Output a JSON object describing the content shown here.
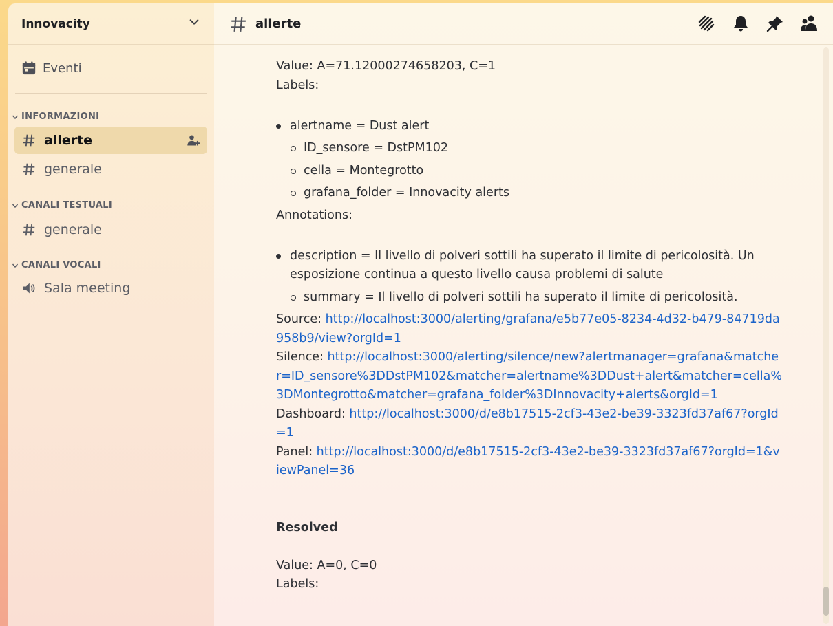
{
  "server": {
    "name": "Innovacity"
  },
  "sidebar": {
    "events_label": "Eventi",
    "categories": [
      {
        "name": "INFORMAZIONI",
        "channels": [
          "allerte",
          "generale"
        ]
      },
      {
        "name": "CANALI TESTUALI",
        "channels": [
          "generale"
        ]
      },
      {
        "name": "CANALI VOCALI",
        "channels": [
          "Sala meeting"
        ]
      }
    ],
    "active_channel": "allerte"
  },
  "header": {
    "channel": "allerte"
  },
  "message": {
    "value1": "Value: A=71.12000274658203, C=1",
    "labels_title": "Labels:",
    "labels": [
      "alertname = Dust alert",
      "ID_sensore = DstPM102",
      "cella = Montegrotto",
      "grafana_folder = Innovacity alerts"
    ],
    "annotations_title": "Annotations:",
    "annotations": [
      "description = Il livello di polveri sottili ha superato il limite di pericolosità. Un esposizione continua a questo livello causa problemi di salute",
      "summary = Il livello di polveri sottili ha superato il limite di pericolosità."
    ],
    "source_label": "Source: ",
    "source_url": "http://localhost:3000/alerting/grafana/e5b77e05-8234-4d32-b479-84719da958b9/view?orgId=1",
    "silence_label": "Silence: ",
    "silence_url": "http://localhost:3000/alerting/silence/new?alertmanager=grafana&matcher=ID_sensore%3DDstPM102&matcher=alertname%3DDust+alert&matcher=cella%3DMontegrotto&matcher=grafana_folder%3DInnovacity+alerts&orgId=1",
    "dashboard_label": "Dashboard: ",
    "dashboard_url": "http://localhost:3000/d/e8b17515-2cf3-43e2-be39-3323fd37af67?orgId=1",
    "panel_label": "Panel: ",
    "panel_url": "http://localhost:3000/d/e8b17515-2cf3-43e2-be39-3323fd37af67?orgId=1&viewPanel=36",
    "resolved_title": "Resolved",
    "value2": "Value: A=0, C=0",
    "labels_title2": "Labels:"
  }
}
